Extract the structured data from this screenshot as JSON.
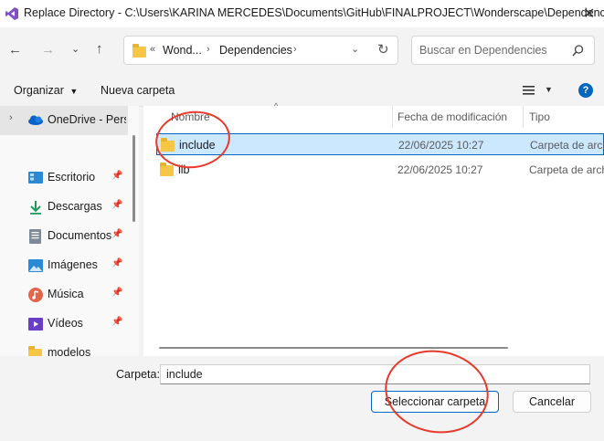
{
  "window": {
    "title": "Replace Directory - C:\\Users\\KARINA MERCEDES\\Documents\\GitHub\\FINALPROJECT\\Wonderscape\\Dependencies"
  },
  "nav": {
    "breadcrumb": [
      "«",
      "Wond...",
      "Dependencies"
    ],
    "search_placeholder": "Buscar en Dependencies"
  },
  "toolbar": {
    "organize_label": "Organizar",
    "new_folder_label": "Nueva carpeta"
  },
  "sidebar": {
    "items": [
      {
        "label": "OneDrive - Personal",
        "icon": "onedrive-icon"
      },
      {
        "label": "Escritorio",
        "icon": "desktop-icon"
      },
      {
        "label": "Descargas",
        "icon": "download-icon"
      },
      {
        "label": "Documentos",
        "icon": "documents-icon"
      },
      {
        "label": "Imágenes",
        "icon": "images-icon"
      },
      {
        "label": "Música",
        "icon": "music-icon"
      },
      {
        "label": "Vídeos",
        "icon": "videos-icon"
      },
      {
        "label": "modelos",
        "icon": "folder-icon"
      }
    ]
  },
  "table": {
    "columns": [
      "Nombre",
      "Fecha de modificación",
      "Tipo"
    ],
    "rows": [
      {
        "name": "include",
        "date": "22/06/2025 10:27",
        "type": "Carpeta de archivos",
        "selected": true
      },
      {
        "name": "lib",
        "date": "22/06/2025 10:27",
        "type": "Carpeta de archivos",
        "selected": false
      }
    ]
  },
  "footer": {
    "folder_label": "Carpeta:",
    "folder_value": "include",
    "select_button": "Seleccionar carpeta",
    "cancel_button": "Cancelar"
  },
  "colors": {
    "accent": "#0067c0",
    "selection_bg": "#cce8ff",
    "annotation": "#e8392a"
  }
}
